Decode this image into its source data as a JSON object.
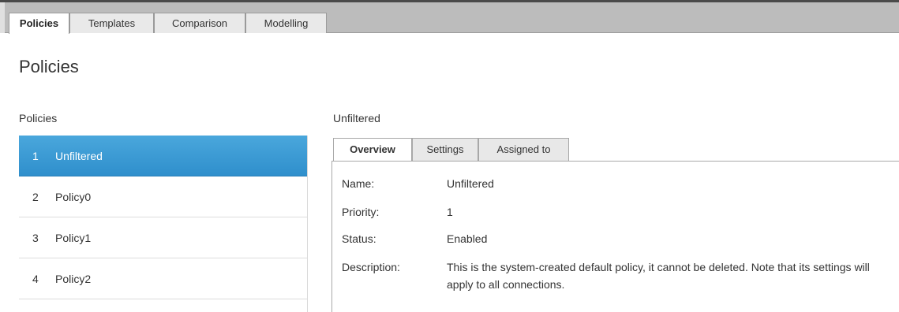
{
  "top_tabs": [
    {
      "label": "Policies",
      "active": true
    },
    {
      "label": "Templates",
      "active": false
    },
    {
      "label": "Comparison",
      "active": false
    },
    {
      "label": "Modelling",
      "active": false
    }
  ],
  "page_title": "Policies",
  "list_heading": "Policies",
  "policies": [
    {
      "num": "1",
      "name": "Unfiltered",
      "selected": true
    },
    {
      "num": "2",
      "name": "Policy0",
      "selected": false
    },
    {
      "num": "3",
      "name": "Policy1",
      "selected": false
    },
    {
      "num": "4",
      "name": "Policy2",
      "selected": false
    }
  ],
  "detail": {
    "heading": "Unfiltered",
    "tabs": [
      {
        "label": "Overview",
        "active": true
      },
      {
        "label": "Settings",
        "active": false
      },
      {
        "label": "Assigned to",
        "active": false
      }
    ],
    "fields": {
      "name_label": "Name:",
      "name_value": "Unfiltered",
      "priority_label": "Priority:",
      "priority_value": "1",
      "status_label": "Status:",
      "status_value": "Enabled",
      "description_label": "Description:",
      "description_value": "This is the system-created default policy, it cannot be deleted. Note that its settings will apply to all connections."
    }
  },
  "colors": {
    "selection": "#3a9ad6",
    "tabbar": "#bcbcbc"
  }
}
